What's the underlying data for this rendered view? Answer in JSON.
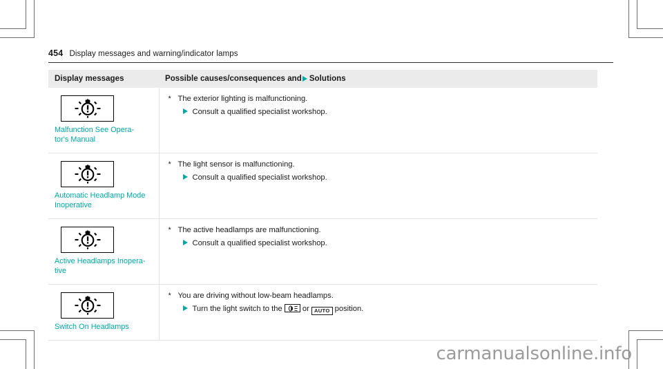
{
  "colors": {
    "accent_teal": "#00a5a5",
    "header_row_bg": "#ebebeb",
    "rule": "#2b2b2b",
    "watermark": "#9b9b9b"
  },
  "running_head": {
    "page_number": "454",
    "title": "Display messages and warning/indicator lamps"
  },
  "table": {
    "headers": {
      "left": "Display messages",
      "right_before_arrow": "Possible causes/consequences and",
      "right_after_arrow": "Solutions"
    },
    "rows": [
      {
        "icon_name": "malfunction-lamp-icon",
        "message": "Malfunction See Opera-\ntor's Manual",
        "cause": "The exterior lighting is malfunctioning.",
        "solution": "Consult a qualified specialist workshop.",
        "solution_has_icons": false
      },
      {
        "icon_name": "malfunction-lamp-icon",
        "message": "Automatic Headlamp Mode\nInoperative",
        "cause": "The light sensor is malfunctioning.",
        "solution": "Consult a qualified specialist workshop.",
        "solution_has_icons": false
      },
      {
        "icon_name": "malfunction-lamp-icon",
        "message": "Active Headlamps Inopera-\ntive",
        "cause": "The active headlamps are malfunctioning.",
        "solution": "Consult a qualified specialist workshop.",
        "solution_has_icons": false
      },
      {
        "icon_name": "malfunction-lamp-icon",
        "message": "Switch On Headlamps",
        "cause": "You are driving without low-beam headlamps.",
        "solution_has_icons": true,
        "solution_parts": {
          "before": "Turn the light switch to the",
          "icon1_name": "low-beam-headlamp-icon",
          "middle": "or",
          "icon2_label": "AUTO",
          "after": "position."
        }
      }
    ],
    "bullet_marker": "*"
  },
  "watermark": "carmanualsonline.info"
}
